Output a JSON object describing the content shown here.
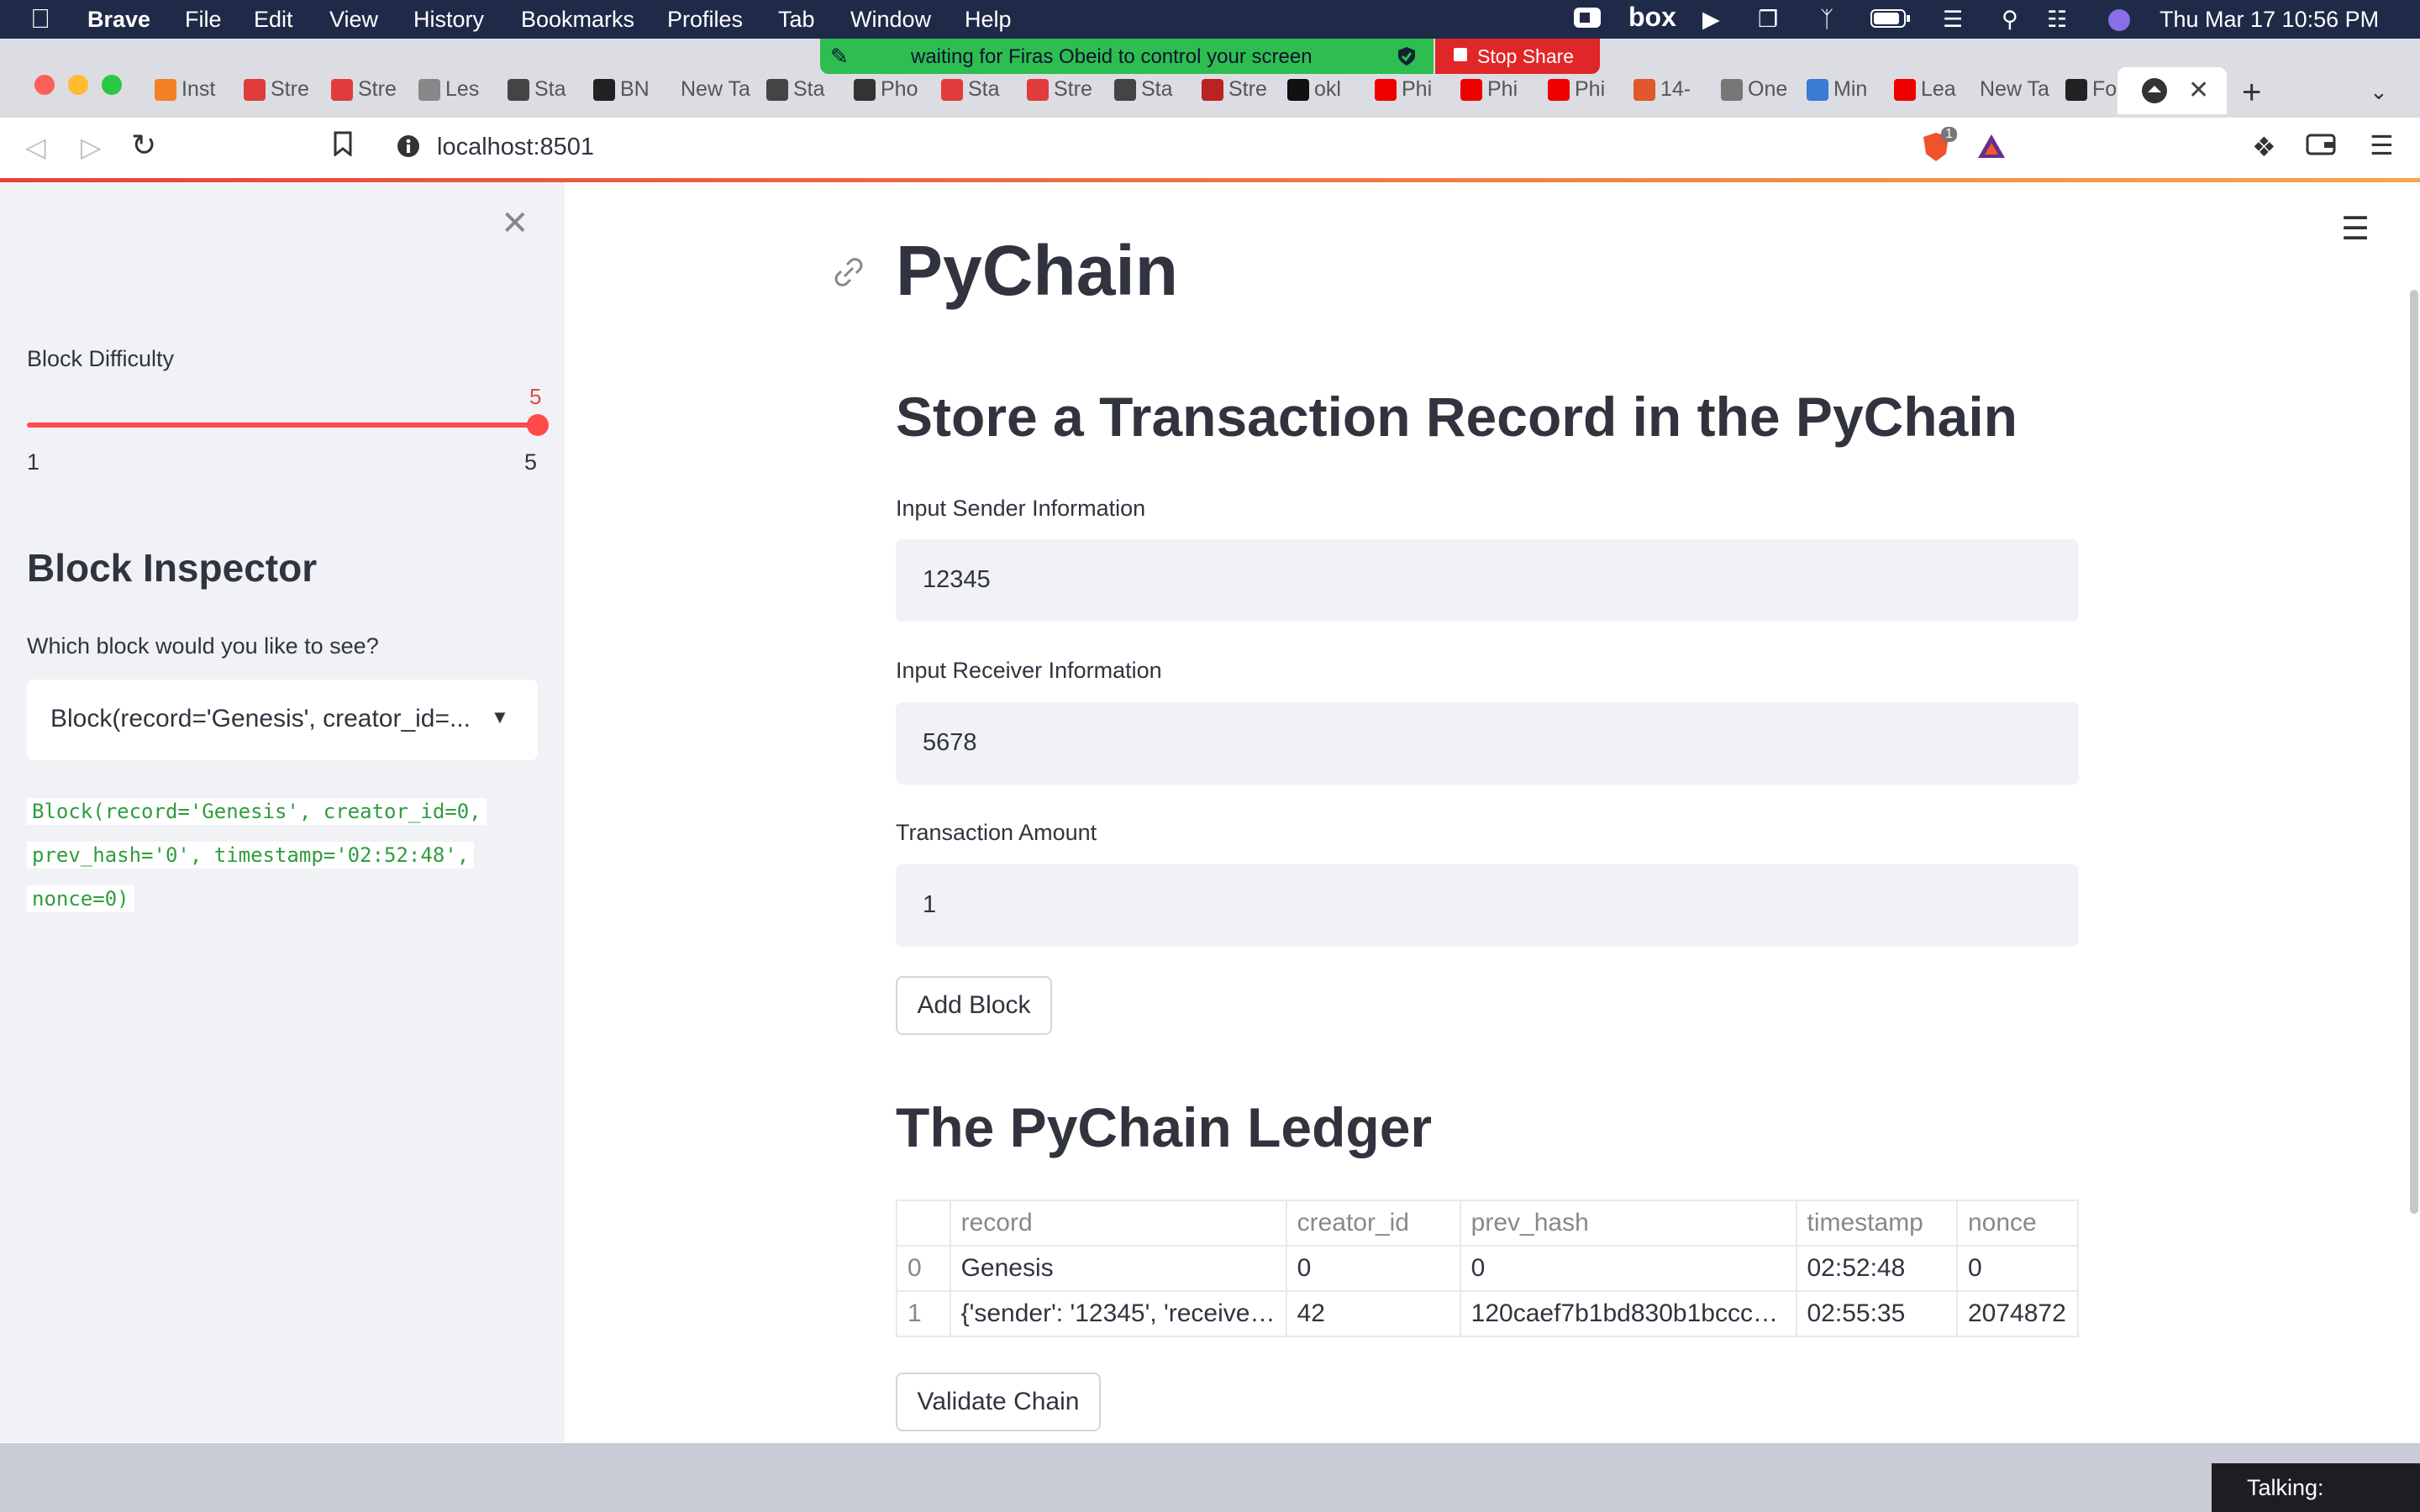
{
  "menubar": {
    "app": "Brave",
    "items": [
      "File",
      "Edit",
      "View",
      "History",
      "Bookmarks",
      "Profiles",
      "Tab",
      "Window",
      "Help"
    ],
    "clock": "Thu Mar 17  10:56 PM"
  },
  "share": {
    "message": "waiting for Firas Obeid to control your screen",
    "stop_label": "Stop Share"
  },
  "tabs": [
    {
      "label": "Inst",
      "color": "#f48024"
    },
    {
      "label": "Stre",
      "color": "#e03c3c"
    },
    {
      "label": "Stre",
      "color": "#e03c3c"
    },
    {
      "label": "Les",
      "color": "#888"
    },
    {
      "label": "Sta",
      "color": "#444"
    },
    {
      "label": "BN",
      "color": "#222"
    },
    {
      "label": "New Ta",
      "color": ""
    },
    {
      "label": "Sta",
      "color": "#444"
    },
    {
      "label": "Pho",
      "color": "#333"
    },
    {
      "label": "Sta",
      "color": "#e03c3c"
    },
    {
      "label": "Stre",
      "color": "#e03c3c"
    },
    {
      "label": "Sta",
      "color": "#444"
    },
    {
      "label": "Stre",
      "color": "#b22"
    },
    {
      "label": "okl",
      "color": "#111"
    },
    {
      "label": "Phi",
      "color": "#e00"
    },
    {
      "label": "Phi",
      "color": "#e00"
    },
    {
      "label": "Phi",
      "color": "#e00"
    },
    {
      "label": "14-",
      "color": "#e2572c"
    },
    {
      "label": "One",
      "color": "#777"
    },
    {
      "label": "Min",
      "color": "#3a7bd5"
    },
    {
      "label": "Lea",
      "color": "#e00"
    },
    {
      "label": "New Ta",
      "color": ""
    },
    {
      "label": "For",
      "color": "#222"
    }
  ],
  "address": {
    "url": "localhost:8501",
    "shield_count": "1"
  },
  "sidebar": {
    "difficulty_label": "Block Difficulty",
    "difficulty_value": "5",
    "difficulty_min": "1",
    "difficulty_max": "5",
    "difficulty_fraction": 1.0,
    "inspector_heading": "Block Inspector",
    "inspector_question": "Which block would you like to see?",
    "select_value": "Block(record='Genesis', creator_id=...",
    "code_lines": [
      "Block(record='Genesis', creator_id=0,",
      "prev_hash='0', timestamp='02:52:48',",
      "nonce=0)"
    ]
  },
  "main": {
    "title": "PyChain",
    "store_heading": "Store a Transaction Record in the PyChain",
    "sender_label": "Input Sender Information",
    "sender_value": "12345",
    "receiver_label": "Input Receiver Information",
    "receiver_value": "5678",
    "amount_label": "Transaction Amount",
    "amount_value": "1",
    "add_button": "Add Block",
    "ledger_heading": "The PyChain Ledger",
    "columns": [
      "",
      "record",
      "creator_id",
      "prev_hash",
      "timestamp",
      "nonce"
    ],
    "rows": [
      [
        "0",
        "Genesis",
        "0",
        "0",
        "02:52:48",
        "0"
      ],
      [
        "1",
        "{'sender': '12345', 'receive…",
        "42",
        "120caef7b1bd830b1bccc…",
        "02:55:35",
        "2074872"
      ]
    ],
    "validate_button": "Validate Chain"
  },
  "dock": {
    "talking": "Talking:"
  }
}
